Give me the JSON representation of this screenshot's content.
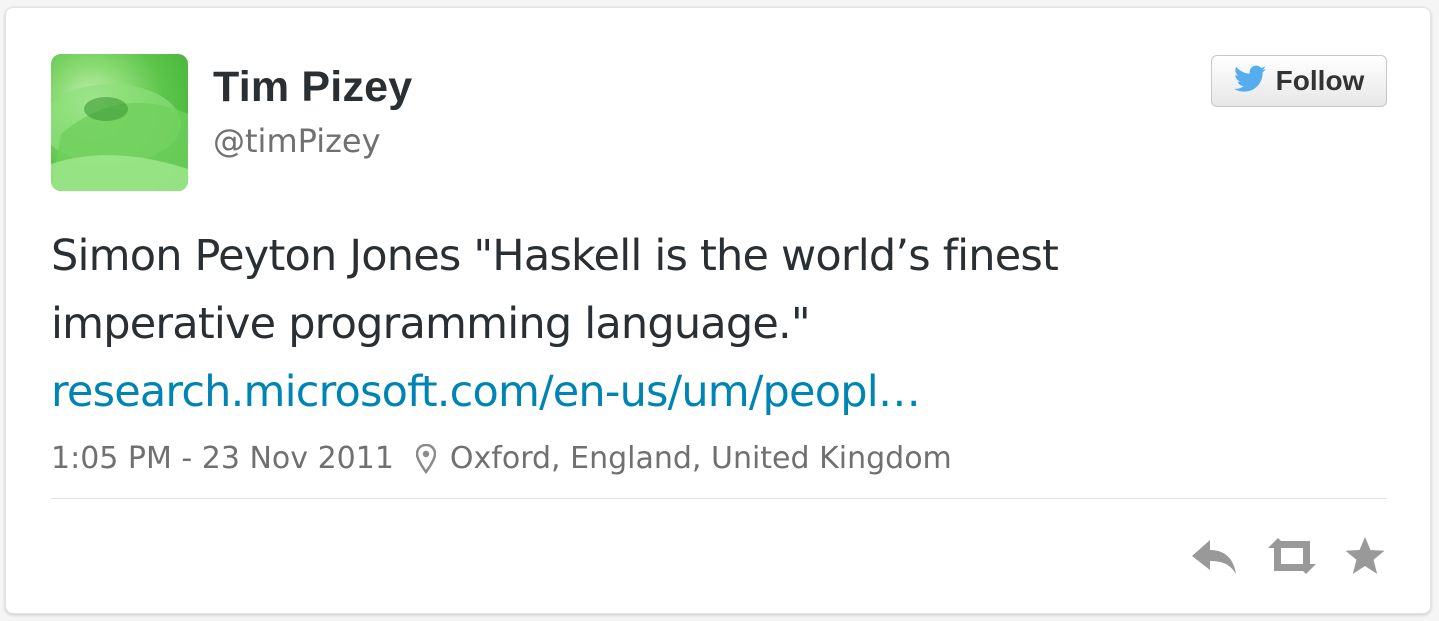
{
  "author": {
    "display_name": "Tim Pizey",
    "handle": "@timPizey"
  },
  "follow_button": {
    "label": "Follow",
    "icon": "twitter-bird-icon"
  },
  "tweet": {
    "text_line_1": "Simon Peyton Jones \"Haskell is the world’s finest",
    "text_line_2": "imperative programming language.\"",
    "link_text": "research.microsoft.com/en-us/um/peopl…"
  },
  "meta": {
    "timestamp": "1:05 PM - 23 Nov 2011",
    "location_icon": "location-pin-icon",
    "location": "Oxford, England, United Kingdom"
  },
  "actions": [
    {
      "name": "reply",
      "icon": "reply-icon"
    },
    {
      "name": "retweet",
      "icon": "retweet-icon"
    },
    {
      "name": "favorite",
      "icon": "star-icon"
    }
  ],
  "colors": {
    "link": "#0084b4",
    "text": "#292f33",
    "muted": "#707070",
    "bird": "#55acee",
    "action_icon": "#999999"
  }
}
